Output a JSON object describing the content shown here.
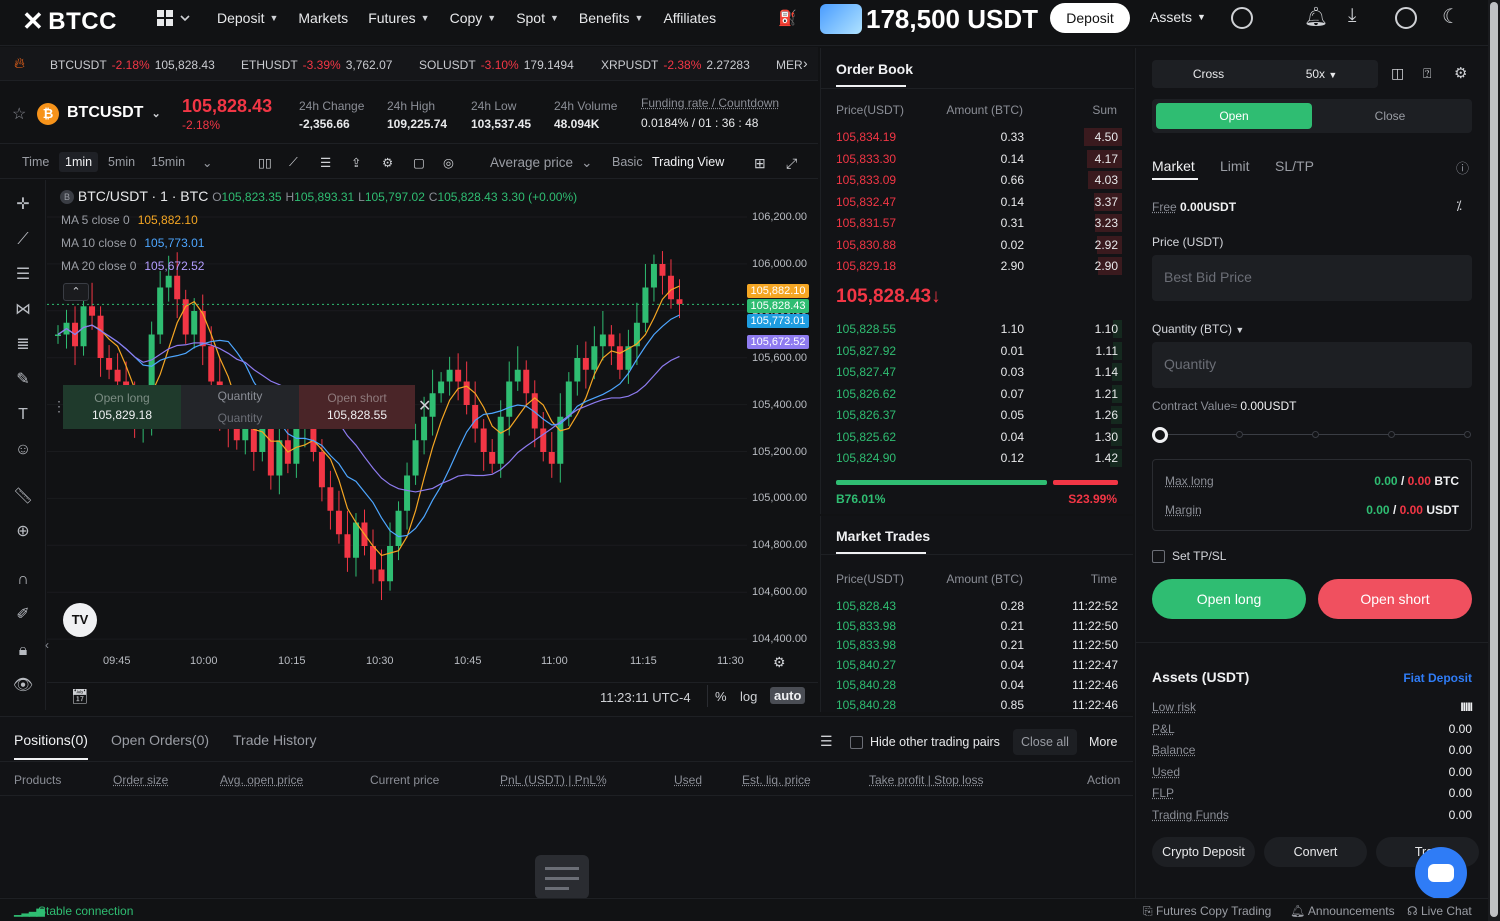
{
  "nav": {
    "brand": "BTCC",
    "items": [
      "Deposit",
      "Markets",
      "Futures",
      "Copy",
      "Spot",
      "Benefits",
      "Affiliates"
    ],
    "has_caret": [
      true,
      false,
      true,
      true,
      true,
      true,
      false
    ],
    "promo_amount": "178,500 USDT",
    "deposit_button": "Deposit",
    "assets": "Assets"
  },
  "ticker": [
    {
      "sym": "BTCUSDT",
      "chg": "-2.18%",
      "price": "105,828.43"
    },
    {
      "sym": "ETHUSDT",
      "chg": "-3.39%",
      "price": "3,762.07"
    },
    {
      "sym": "SOLUSDT",
      "chg": "-3.10%",
      "price": "179.1494"
    },
    {
      "sym": "XRPUSDT",
      "chg": "-2.38%",
      "price": "2.27283"
    },
    {
      "sym": "MER",
      "chg": "",
      "price": ""
    }
  ],
  "symbol": {
    "name": "BTCUSDT",
    "coin_letter": "₿",
    "price": "105,828.43",
    "pct": "-2.18%",
    "stats": [
      {
        "label": "24h Change",
        "value": "-2,356.66"
      },
      {
        "label": "24h High",
        "value": "109,225.74"
      },
      {
        "label": "24h Low",
        "value": "103,537.45"
      },
      {
        "label": "24h Volume",
        "value": "48.094K"
      },
      {
        "label": "Funding rate / Countdown",
        "value": "0.0184% / 01 : 36 : 48"
      }
    ]
  },
  "chart_toolbar": {
    "time": "Time",
    "intervals": [
      "1min",
      "5min",
      "15min"
    ],
    "selected": "1min",
    "price_type": "Average price",
    "basic": "Basic",
    "trading_view": "Trading View"
  },
  "chart_legend": {
    "title": "BTC/USDT · 1 · BTC",
    "o": "105,823.35",
    "h": "105,893.31",
    "l": "105,797.02",
    "c": "105,828.43",
    "chg": "3.30 (+0.00%)",
    "ma": [
      {
        "label": "MA 5 close 0",
        "value": "105,882.10",
        "color": "#f5a623"
      },
      {
        "label": "MA 10 close 0",
        "value": "105,773.01",
        "color": "#4da6ff"
      },
      {
        "label": "MA 20 close 0",
        "value": "105,672.52",
        "color": "#b39dff"
      }
    ]
  },
  "chart_data": {
    "type": "candlestick",
    "y_ticks": [
      "106,200.00",
      "106,000.00",
      "105,800.00",
      "105,600.00",
      "105,400.00",
      "105,200.00",
      "105,000.00",
      "104,800.00",
      "104,600.00",
      "104,400.00"
    ],
    "x_ticks": [
      "09:45",
      "10:00",
      "10:15",
      "10:30",
      "10:45",
      "11:00",
      "11:15",
      "11:30"
    ],
    "price_labels": [
      {
        "value": "105,882.10",
        "color": "#f5a623"
      },
      {
        "value": "105,828.43",
        "color": "#2fbd72"
      },
      {
        "value": "105,773.01",
        "color": "#1e9de0"
      },
      {
        "value": "105,672.52",
        "color": "#8e7bf0"
      }
    ]
  },
  "chart_order_panel": {
    "long_label": "Open long",
    "long_price": "105,829.18",
    "qty_label": "Quantity",
    "qty_placeholder": "Quantity",
    "short_label": "Open short",
    "short_price": "105,828.55"
  },
  "chart_footer": {
    "time": "11:23:11 UTC-4",
    "pct": "%",
    "log": "log",
    "auto": "auto"
  },
  "orderbook": {
    "title": "Order Book",
    "headers": [
      "Price(USDT)",
      "Amount (BTC)",
      "Sum"
    ],
    "asks": [
      {
        "p": "105,834.19",
        "a": "0.33",
        "s": "4.50"
      },
      {
        "p": "105,833.30",
        "a": "0.14",
        "s": "4.17"
      },
      {
        "p": "105,833.09",
        "a": "0.66",
        "s": "4.03"
      },
      {
        "p": "105,832.47",
        "a": "0.14",
        "s": "3.37"
      },
      {
        "p": "105,831.57",
        "a": "0.31",
        "s": "3.23"
      },
      {
        "p": "105,830.88",
        "a": "0.02",
        "s": "2.92"
      },
      {
        "p": "105,829.18",
        "a": "2.90",
        "s": "2.90"
      }
    ],
    "mid": "105,828.43↓",
    "bids": [
      {
        "p": "105,828.55",
        "a": "1.10",
        "s": "1.10"
      },
      {
        "p": "105,827.92",
        "a": "0.01",
        "s": "1.11"
      },
      {
        "p": "105,827.47",
        "a": "0.03",
        "s": "1.14"
      },
      {
        "p": "105,826.62",
        "a": "0.07",
        "s": "1.21"
      },
      {
        "p": "105,826.37",
        "a": "0.05",
        "s": "1.26"
      },
      {
        "p": "105,825.62",
        "a": "0.04",
        "s": "1.30"
      },
      {
        "p": "105,824.90",
        "a": "0.12",
        "s": "1.42"
      }
    ],
    "buy_ratio": "B76.01%",
    "sell_ratio": "S23.99%",
    "buy_fraction": 0.7601
  },
  "trades": {
    "title": "Market Trades",
    "headers": [
      "Price(USDT)",
      "Amount (BTC)",
      "Time"
    ],
    "rows": [
      {
        "p": "105,828.43",
        "a": "0.28",
        "t": "11:22:52"
      },
      {
        "p": "105,833.98",
        "a": "0.21",
        "t": "11:22:50"
      },
      {
        "p": "105,833.98",
        "a": "0.21",
        "t": "11:22:50"
      },
      {
        "p": "105,840.27",
        "a": "0.04",
        "t": "11:22:47"
      },
      {
        "p": "105,840.28",
        "a": "0.04",
        "t": "11:22:46"
      },
      {
        "p": "105,840.28",
        "a": "0.85",
        "t": "11:22:46"
      }
    ]
  },
  "trade_panel": {
    "margin_mode": "Cross",
    "leverage": "50x",
    "open": "Open",
    "close": "Close",
    "order_tabs": [
      "Market",
      "Limit",
      "SL/TP"
    ],
    "free_label": "Free",
    "free_value": "0.00USDT",
    "price_label": "Price (USDT)",
    "price_placeholder": "Best Bid Price",
    "qty_label": "Quantity (BTC)",
    "qty_placeholder": "Quantity",
    "contract_label": "Contract Value≈",
    "contract_value": "0.00USDT",
    "max_long_label": "Max long",
    "max_long_g": "0.00",
    "max_long_r": "0.00",
    "max_long_unit": "BTC",
    "margin_label": "Margin",
    "margin_g": "0.00",
    "margin_r": "0.00",
    "margin_unit": "USDT",
    "tpsl": "Set TP/SL",
    "open_long": "Open long",
    "open_short": "Open short"
  },
  "assets_panel": {
    "title": "Assets (USDT)",
    "fiat": "Fiat Deposit",
    "rows": [
      {
        "label": "Low risk",
        "value": "IIIII"
      },
      {
        "label": "P&L",
        "value": "0.00"
      },
      {
        "label": "Balance",
        "value": "0.00"
      },
      {
        "label": "Used",
        "value": "0.00"
      },
      {
        "label": "FLP",
        "value": "0.00"
      },
      {
        "label": "Trading Funds",
        "value": "0.00"
      }
    ],
    "buttons": [
      "Crypto Deposit",
      "Convert",
      "Tran"
    ]
  },
  "positions": {
    "tabs": [
      "Positions(0)",
      "Open Orders(0)",
      "Trade History"
    ],
    "hide_pairs": "Hide other trading pairs",
    "close_all": "Close all",
    "more": "More",
    "columns": [
      "Products",
      "Order size",
      "Avg. open price",
      "Current price",
      "PnL (USDT) | PnL%",
      "Used",
      "Est. liq. price",
      "Take profit | Stop loss",
      "Action"
    ]
  },
  "status": {
    "connection": "Stable connection",
    "links": [
      "Futures Copy Trading",
      "Announcements",
      "Live Chat"
    ]
  }
}
